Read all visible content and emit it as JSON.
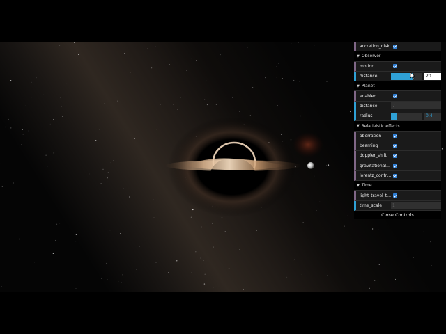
{
  "gui": {
    "top": {
      "accretion_disk": {
        "label": "accretion_disk",
        "checked": true
      }
    },
    "observer": {
      "title": "Observer",
      "motion": {
        "label": "motion",
        "checked": true
      },
      "distance": {
        "label": "distance",
        "value": "20",
        "fill": 0.7
      }
    },
    "planet": {
      "title": "Planet",
      "enabled": {
        "label": "enabled",
        "checked": true
      },
      "distance": {
        "label": "distance",
        "value": "7"
      },
      "radius": {
        "label": "radius",
        "value": "0.4",
        "fill": 0.2
      }
    },
    "relativistic": {
      "title": "Relativistic effects",
      "aberration": {
        "label": "aberration",
        "checked": true
      },
      "beaming": {
        "label": "beaming",
        "checked": true
      },
      "doppler_shift": {
        "label": "doppler_shift",
        "checked": true
      },
      "gravitational_time": {
        "label": "gravitational_ti...",
        "checked": true
      },
      "lorentz_contraction": {
        "label": "lorentz_contra...",
        "checked": true
      }
    },
    "time": {
      "title": "Time",
      "light_travel_time": {
        "label": "light_travel_time",
        "checked": true
      },
      "time_scale": {
        "label": "time_scale",
        "value": "1"
      }
    },
    "close_label": "Close Controls"
  },
  "colors": {
    "boolean_accent": "#806787",
    "number_accent": "#2fa1d6",
    "checkbox": "#2f7fd6",
    "gui_background": "#1a1a1a"
  },
  "scene": {
    "objects": [
      "black-hole",
      "accretion-disk",
      "planet",
      "milky-way",
      "stars"
    ]
  }
}
